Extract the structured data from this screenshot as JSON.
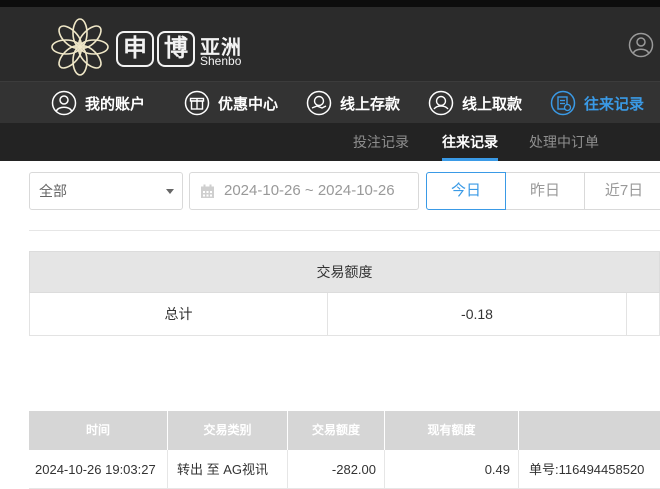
{
  "brand": {
    "char1": "申",
    "char2": "博",
    "cn_suffix": "亚洲",
    "en_name": "Shenbo",
    "accent_color": "#3a9ae6"
  },
  "main_nav": [
    {
      "label": "我的账户",
      "icon": "user-icon"
    },
    {
      "label": "优惠中心",
      "icon": "gift-icon"
    },
    {
      "label": "线上存款",
      "icon": "deposit-icon"
    },
    {
      "label": "线上取款",
      "icon": "withdraw-icon"
    },
    {
      "label": "往来记录",
      "icon": "records-icon",
      "active": true
    }
  ],
  "sub_nav": [
    {
      "label": "投注记录"
    },
    {
      "label": "往来记录",
      "active": true
    },
    {
      "label": "处理中订单"
    }
  ],
  "filters": {
    "type_select": "全部",
    "date_range": "2024-10-26 ~ 2024-10-26",
    "quick": [
      "今日",
      "昨日",
      "近7日"
    ],
    "quick_active": "今日"
  },
  "summary": {
    "header": "交易额度",
    "row_label": "总计",
    "amount": "-0.18"
  },
  "transactions": {
    "columns": [
      "时间",
      "交易类别",
      "交易额度",
      "现有额度",
      ""
    ],
    "rows": [
      {
        "time": "2024-10-26 19:03:27",
        "type": "转出 至 AG视讯",
        "amount": "-282.00",
        "balance": "0.49",
        "order": "单号:116494458520"
      }
    ]
  }
}
